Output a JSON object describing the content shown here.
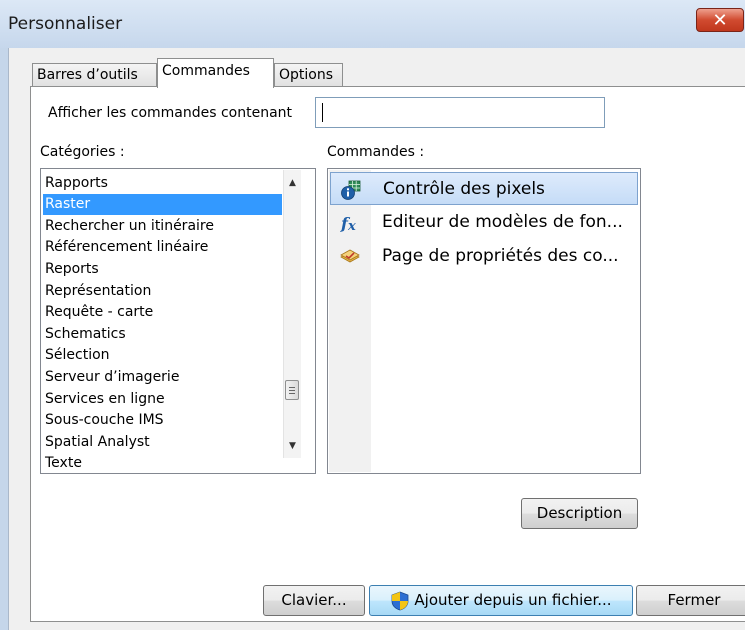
{
  "window": {
    "title": "Personnaliser",
    "close_glyph": "✕"
  },
  "tabs": [
    {
      "label": "Barres d’outils",
      "active": false
    },
    {
      "label": "Commandes",
      "active": true
    },
    {
      "label": "Options",
      "active": false
    }
  ],
  "filter": {
    "label": "Afficher les commandes contenant",
    "value": ""
  },
  "categories": {
    "label": "Catégories :",
    "selected": "Raster",
    "items": [
      "Rapports",
      "Raster",
      "Rechercher un itinéraire",
      "Référencement linéaire",
      "Reports",
      "Représentation",
      "Requête - carte",
      "Schematics",
      "Sélection",
      "Serveur d’imagerie",
      "Services en ligne",
      "Sous-couche IMS",
      "Spatial Analyst",
      "Texte"
    ]
  },
  "commands": {
    "label": "Commandes :",
    "items": [
      {
        "label": "Contrôle des pixels",
        "icon": "pixel-inspector-icon",
        "selected": true
      },
      {
        "label": "Editeur de modèles de fon...",
        "icon": "function-template-icon",
        "selected": false
      },
      {
        "label": "Page de propriétés des co...",
        "icon": "layer-properties-icon",
        "selected": false
      }
    ]
  },
  "buttons": {
    "description": "Description",
    "keyboard": "Clavier...",
    "add_from_file": "Ajouter depuis un fichier...",
    "close": "Fermer"
  },
  "colors": {
    "selection": "#3399ff",
    "title_bar": "#c6d7ec",
    "close_button": "#d14b30"
  }
}
